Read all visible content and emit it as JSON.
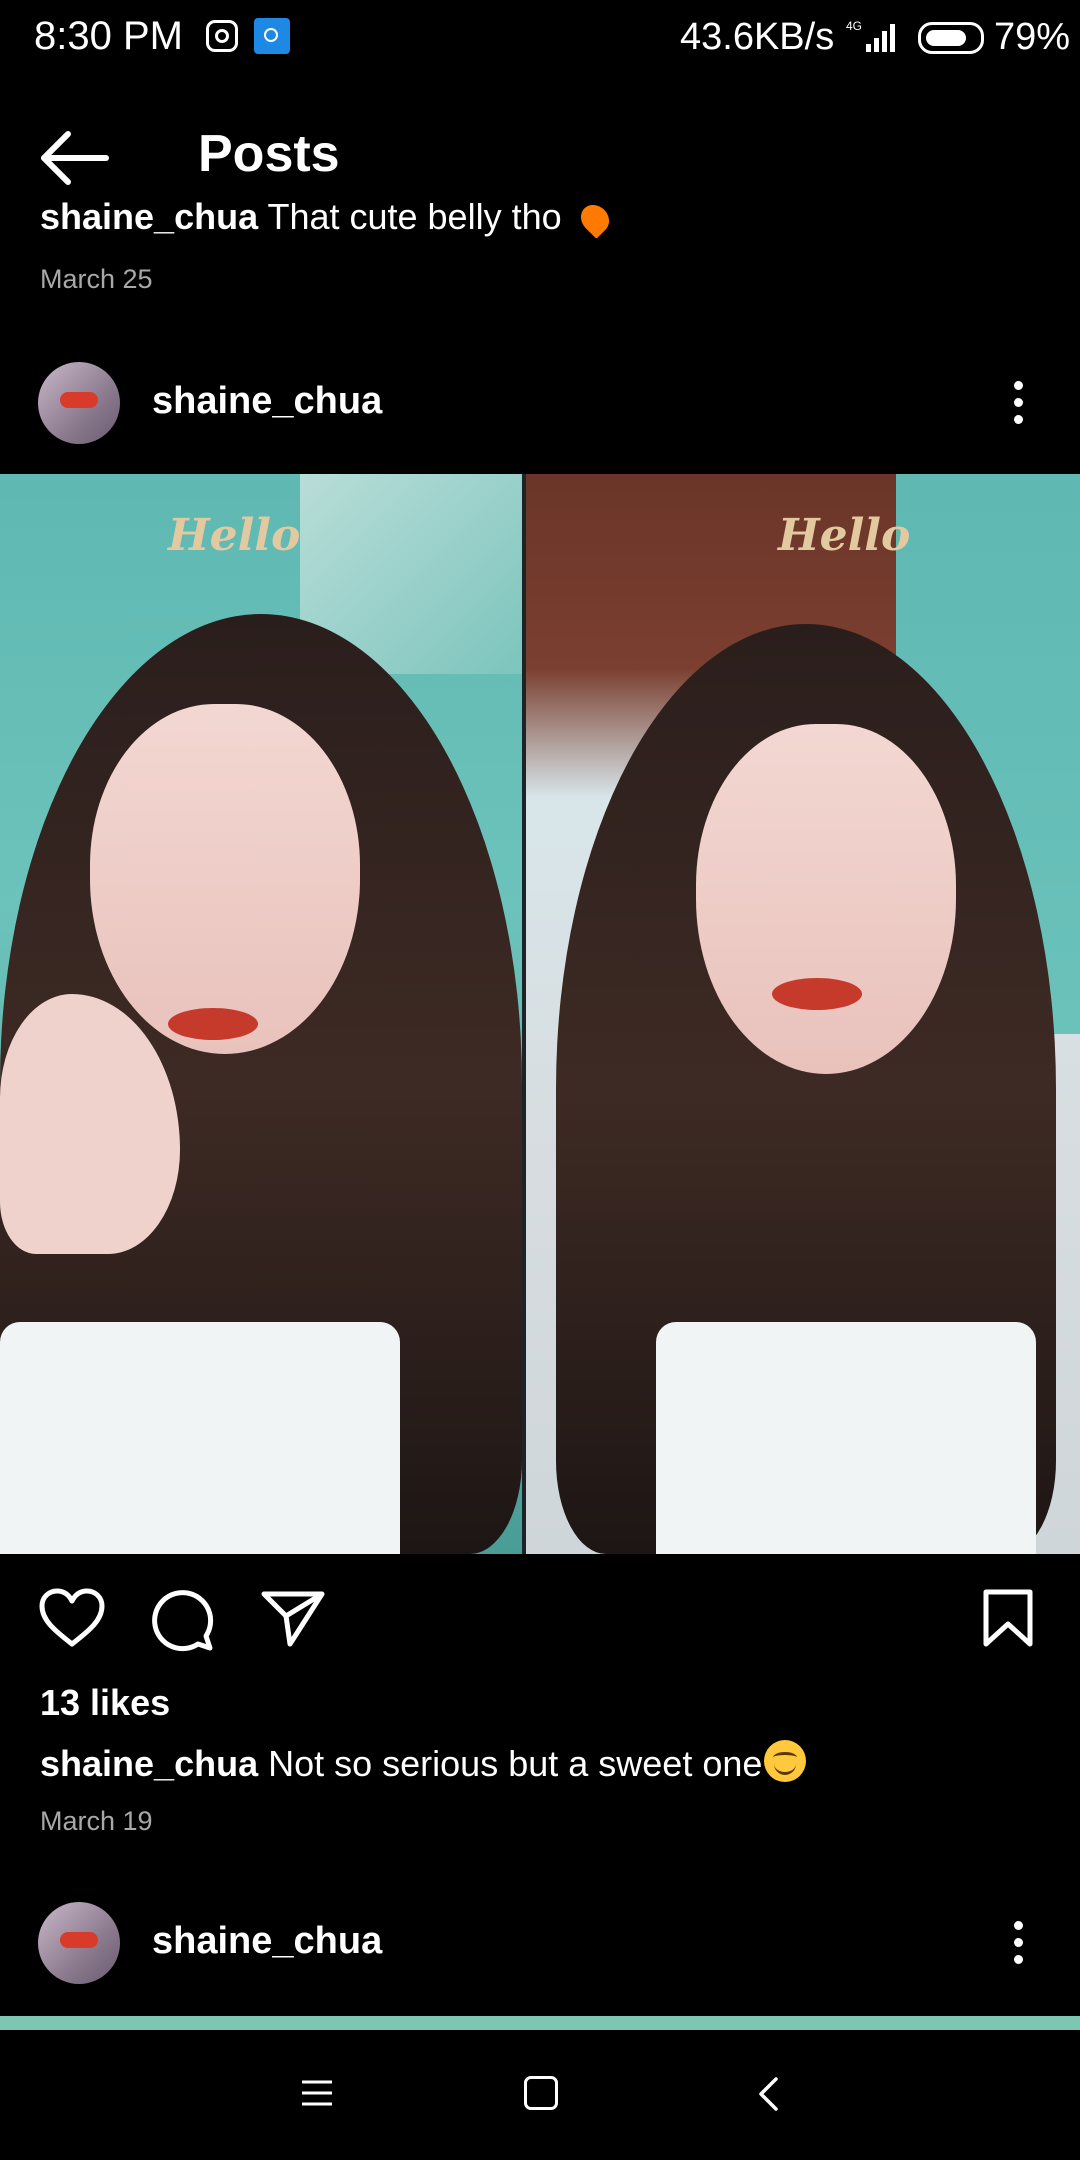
{
  "status_bar": {
    "time": "8:30 PM",
    "speed": "43.6KB/s",
    "network": "4G",
    "battery_percent": "79%",
    "battery_level": 0.79,
    "icons": [
      "instagram-icon",
      "app-notification-icon",
      "signal-icon",
      "battery-icon"
    ]
  },
  "header": {
    "title": "Posts",
    "back_icon": "arrow-left-icon"
  },
  "previous_post": {
    "caption_user": "shaine_chua",
    "caption_text": "That cute belly tho",
    "date": "March 25"
  },
  "post": {
    "username": "shaine_chua",
    "image_text_left": "Hello",
    "image_text_right": "Hello",
    "likes": "13 likes",
    "caption_user": "shaine_chua",
    "caption_text": "Not so serious but a sweet one",
    "date": "March 19"
  },
  "next_post": {
    "username": "shaine_chua"
  },
  "colors": {
    "background": "#000000",
    "secondary_text": "#a8a8a8",
    "image_teal": "#5fb8b2"
  }
}
